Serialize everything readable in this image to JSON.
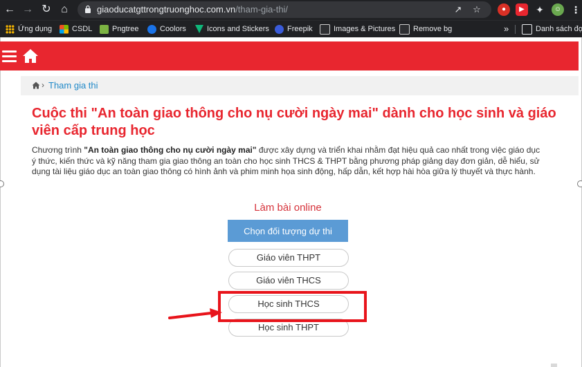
{
  "browser": {
    "url_domain": "giaoducatgttrongtruonghoc.com.vn",
    "url_path": "/tham-gia-thi/"
  },
  "bookmarks": [
    {
      "label": "Ứng dụng",
      "icon": "apps-grid-icon",
      "color": "#f4b400"
    },
    {
      "label": "CSDL",
      "icon": "microsoft-icon",
      "color": "#f25022"
    },
    {
      "label": "Pngtree",
      "icon": "pngtree-icon",
      "color": "#7cb342"
    },
    {
      "label": "Coolors",
      "icon": "coolors-icon",
      "color": "#1a73e8"
    },
    {
      "label": "Icons and Stickers",
      "icon": "flaticon-icon",
      "color": "#0fb77a"
    },
    {
      "label": "Freepik",
      "icon": "freepik-icon",
      "color": "#3a5bd9"
    },
    {
      "label": "Images & Pictures",
      "icon": "images-icon",
      "color": "#cfcfcf"
    },
    {
      "label": "Remove bg",
      "icon": "removebg-icon",
      "color": "#cfcfcf"
    },
    {
      "label": "»",
      "icon": "overflow-chevron-icon"
    },
    {
      "label": "Danh sách đọc",
      "icon": "reading-list-icon",
      "color": "#e8eaed"
    }
  ],
  "breadcrumb": {
    "link": "Tham gia thi"
  },
  "content": {
    "title": "Cuộc thi \"An toàn giao thông cho nụ cười ngày mai\" dành cho học sinh và giáo viên cấp trung học",
    "intro_prefix": "Chương trình ",
    "intro_bold": "\"An toàn giao thông cho nụ cười ngày mai\"",
    "intro_rest": " được xây dựng và triển khai nhằm đạt hiệu quả cao nhất trong việc giáo dục ý thức, kiến thức và kỹ năng tham gia giao thông an toàn cho học sinh THCS & THPT bằng phương pháp giảng dạy đơn giản, dễ hiểu, sử dụng tài liệu giáo dục an toàn giao thông có hình ảnh và phim minh họa sinh động, hấp dẫn, kết hợp hài hòa giữa lý thuyết và thực hành."
  },
  "quiz": {
    "heading": "Làm bài online",
    "choose_label": "Chọn đối tượng dự thi",
    "options": [
      "Giáo viên THPT",
      "Giáo viên THCS",
      "Học sinh THCS",
      "Học sinh THPT"
    ],
    "highlighted": "Học sinh THCS"
  },
  "colors": {
    "brand_red": "#e8262f",
    "link_blue": "#1e88c8",
    "button_blue": "#5b9bd5",
    "annotation_red": "#e8141b"
  }
}
